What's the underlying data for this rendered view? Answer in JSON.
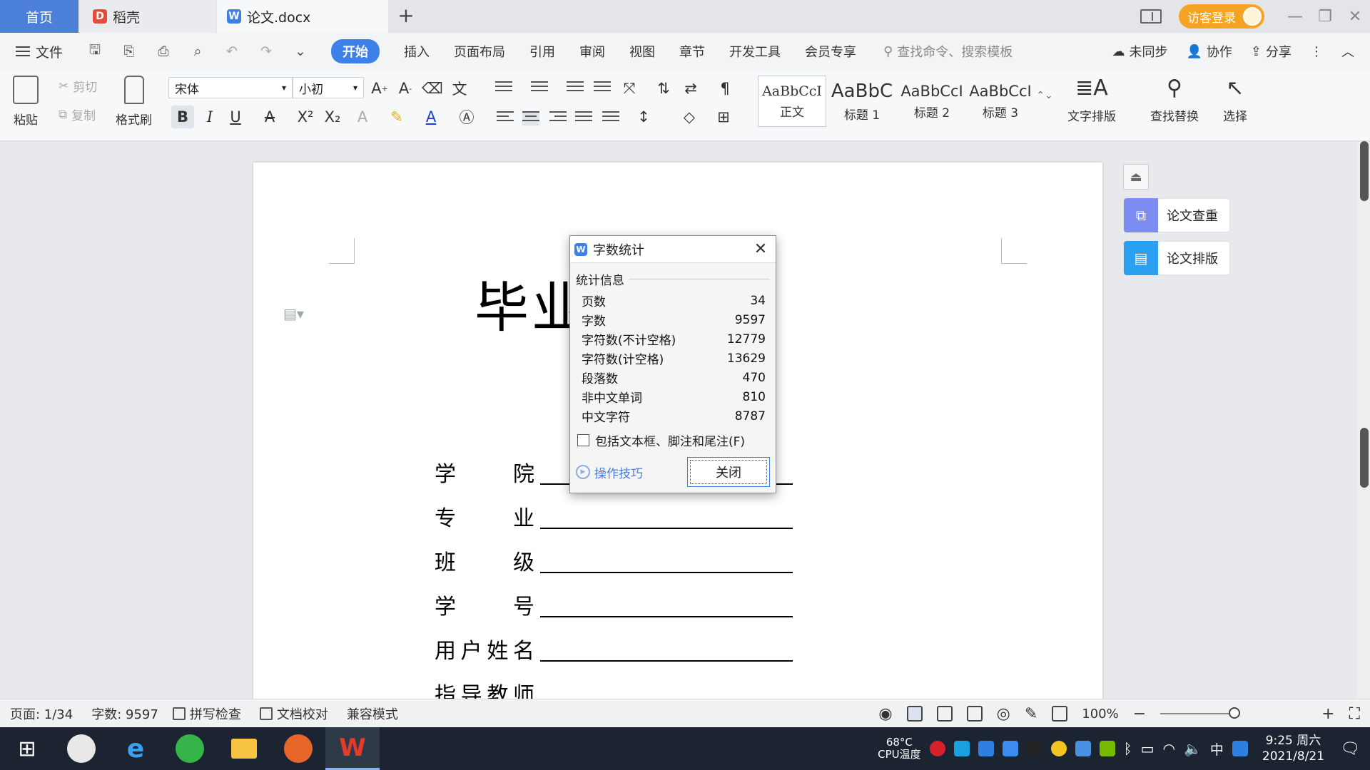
{
  "tabs": {
    "home": "首页",
    "daoke": "稻壳",
    "doc": "论文.docx",
    "new_tab": "+"
  },
  "header_right": {
    "login": "访客登录"
  },
  "menubar": {
    "file": "文件",
    "tabs": [
      "开始",
      "插入",
      "页面布局",
      "引用",
      "审阅",
      "视图",
      "章节",
      "开发工具",
      "会员专享"
    ],
    "search_placeholder": "查找命令、搜索模板",
    "sync": "未同步",
    "collab": "协作",
    "share": "分享"
  },
  "ribbon": {
    "paste": "粘贴",
    "cut": "剪切",
    "copy": "复制",
    "format_painter": "格式刷",
    "font_name": "宋体",
    "font_size": "小初",
    "styles": [
      {
        "sample": "AaBbCcI",
        "label": "正文"
      },
      {
        "sample": "AaBbC",
        "label": "标题 1"
      },
      {
        "sample": "AaBbCcI",
        "label": "标题 2"
      },
      {
        "sample": "AaBbCcI",
        "label": "标题 3"
      }
    ],
    "text_layout": "文字排版",
    "find_replace": "查找替换",
    "select": "选择"
  },
  "document": {
    "title_visible": "毕业                文）",
    "fields": [
      "学　院",
      "专　业",
      "班　级",
      "学　号",
      "用户姓名",
      "指导教师"
    ]
  },
  "side_panel": {
    "check": "论文查重",
    "layout": "论文排版"
  },
  "dialog": {
    "title": "字数统计",
    "section": "统计信息",
    "stats": [
      {
        "label": "页数",
        "value": "34"
      },
      {
        "label": "字数",
        "value": "9597"
      },
      {
        "label": "字符数(不计空格)",
        "value": "12779"
      },
      {
        "label": "字符数(计空格)",
        "value": "13629"
      },
      {
        "label": "段落数",
        "value": "470"
      },
      {
        "label": "非中文单词",
        "value": "810"
      },
      {
        "label": "中文字符",
        "value": "8787"
      }
    ],
    "checkbox_label": "包括文本框、脚注和尾注(F)",
    "checkbox_checked": false,
    "tips": "操作技巧",
    "close": "关闭"
  },
  "statusbar": {
    "page": "页面: 1/34",
    "words": "字数: 9597",
    "spell": "拼写检查",
    "proof": "文档校对",
    "compat": "兼容模式",
    "zoom": "100%"
  },
  "taskbar": {
    "cpu_temp": "68°C",
    "cpu_label": "CPU温度",
    "ime": "中",
    "time": "9:25 周六",
    "date": "2021/8/21"
  },
  "colors": {
    "accent": "#3d80e8",
    "home_tab": "#4b7fd8",
    "login": "#f4a422",
    "taskbar": "#1b2430"
  }
}
